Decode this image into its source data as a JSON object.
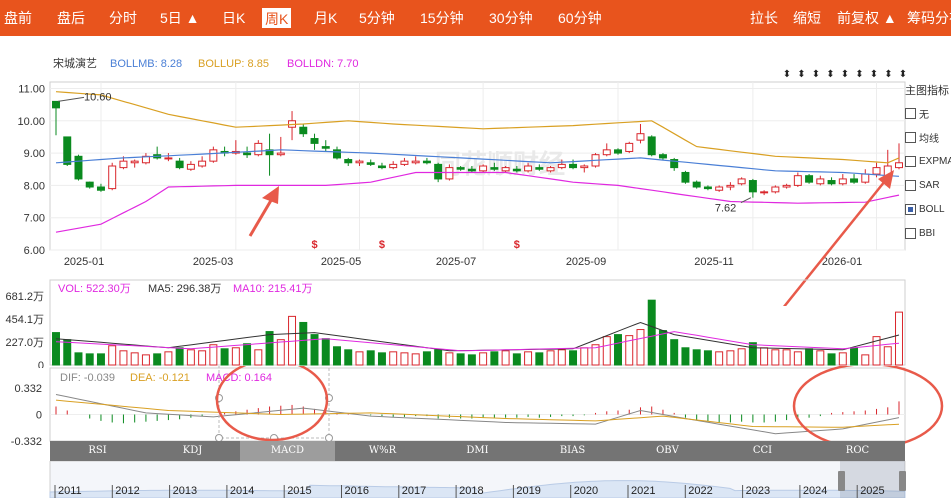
{
  "toolbar": {
    "left_items": [
      "盘前",
      "盘后",
      "分时",
      "5日 ▲",
      "日K",
      "周K",
      "月K",
      "5分钟",
      "15分钟",
      "30分钟",
      "60分钟"
    ],
    "active": "周K",
    "right_items": [
      "拉长",
      "缩短",
      "前复权 ▲",
      "筹码分布"
    ],
    "color": "#e8541d"
  },
  "legend": {
    "stock_name": "宋城演艺",
    "bollmb": "BOLLMB: 8.28",
    "bollup": "BOLLUP: 8.85",
    "bolldn": "BOLLDN: 7.70"
  },
  "indicator_panel": {
    "title": "主图指标",
    "items": [
      {
        "label": "无",
        "checked": false
      },
      {
        "label": "均线",
        "checked": false
      },
      {
        "label": "EXPMA",
        "checked": false
      },
      {
        "label": "SAR",
        "checked": false
      },
      {
        "label": "BOLL",
        "checked": true
      },
      {
        "label": "BBI",
        "checked": false
      }
    ]
  },
  "annotations": {
    "high": "10.60",
    "low": "7.62",
    "ex_rights_marker": "$",
    "dividend_marker": "⬍"
  },
  "vol_legend": {
    "vol": "VOL: 522.30万",
    "ma5": "MA5: 296.38万",
    "ma10": "MA10: 215.41万"
  },
  "macd_legend": {
    "dif": "DIF: -0.039",
    "dea": "DEA: -0.121",
    "macd": "MACD: 0.164"
  },
  "tabs": [
    "RSI",
    "KDJ",
    "MACD",
    "W%R",
    "DMI",
    "BIAS",
    "OBV",
    "CCI",
    "ROC"
  ],
  "active_tab": "MACD",
  "colors": {
    "up": "#d9262c",
    "down": "#0a8a1f",
    "mid": "#4a7fd6",
    "upper": "#d9a023",
    "lower": "#e029e0",
    "dif": "#888888",
    "dea": "#d9a023",
    "macd": "#e029e0",
    "annotation": "#e85a4a"
  },
  "chart_data": [
    {
      "type": "candlestick",
      "title": "宋城演艺 周K",
      "x_labels": [
        "2025-01",
        "2025-03",
        "2025-05",
        "2025-07",
        "2025-09",
        "2025-11",
        "2026-01"
      ],
      "y_ticks": [
        "6.00",
        "7.00",
        "8.00",
        "9.00",
        "10.00",
        "11.00"
      ],
      "ylim": [
        6,
        11.2
      ],
      "ohlc": [
        [
          10.6,
          10.4,
          10.6,
          9.55
        ],
        [
          9.5,
          8.65,
          9.5,
          8.6
        ],
        [
          8.9,
          8.2,
          8.95,
          8.15
        ],
        [
          8.1,
          7.95,
          8.12,
          7.9
        ],
        [
          7.95,
          7.85,
          8.05,
          7.8
        ],
        [
          7.9,
          8.6,
          8.7,
          7.85
        ],
        [
          8.55,
          8.75,
          8.9,
          8.5
        ],
        [
          8.7,
          8.75,
          8.8,
          8.55
        ],
        [
          8.7,
          8.9,
          9.0,
          8.65
        ],
        [
          8.95,
          8.85,
          9.2,
          8.8
        ],
        [
          8.85,
          8.85,
          9.0,
          8.75
        ],
        [
          8.75,
          8.55,
          8.85,
          8.5
        ],
        [
          8.5,
          8.65,
          8.75,
          8.45
        ],
        [
          8.6,
          8.75,
          8.9,
          8.55
        ],
        [
          8.75,
          9.1,
          9.2,
          8.7
        ],
        [
          9.05,
          9.0,
          9.2,
          8.9
        ],
        [
          9.0,
          9.05,
          9.4,
          8.95
        ],
        [
          9.0,
          8.95,
          9.2,
          8.85
        ],
        [
          8.95,
          9.3,
          9.4,
          8.9
        ],
        [
          9.1,
          8.95,
          9.6,
          8.3
        ],
        [
          8.95,
          9.0,
          9.5,
          8.9
        ],
        [
          9.8,
          10.0,
          10.3,
          9.4
        ],
        [
          9.8,
          9.6,
          9.9,
          9.5
        ],
        [
          9.45,
          9.3,
          9.6,
          9.1
        ],
        [
          9.2,
          9.15,
          9.4,
          9.05
        ],
        [
          9.1,
          8.85,
          9.2,
          8.8
        ],
        [
          8.8,
          8.7,
          8.85,
          8.6
        ],
        [
          8.7,
          8.75,
          8.8,
          8.6
        ],
        [
          8.7,
          8.65,
          8.8,
          8.6
        ],
        [
          8.6,
          8.55,
          8.7,
          8.5
        ],
        [
          8.55,
          8.65,
          8.75,
          8.5
        ],
        [
          8.65,
          8.75,
          8.85,
          8.6
        ],
        [
          8.7,
          8.75,
          8.9,
          8.65
        ],
        [
          8.75,
          8.7,
          8.85,
          8.65
        ],
        [
          8.65,
          8.2,
          8.7,
          8.1
        ],
        [
          8.2,
          8.55,
          8.65,
          8.15
        ],
        [
          8.55,
          8.5,
          8.6,
          8.45
        ],
        [
          8.5,
          8.45,
          8.6,
          8.4
        ],
        [
          8.45,
          8.6,
          8.65,
          8.4
        ],
        [
          8.55,
          8.5,
          8.7,
          8.45
        ],
        [
          8.45,
          8.55,
          8.6,
          8.4
        ],
        [
          8.5,
          8.45,
          8.6,
          8.4
        ],
        [
          8.45,
          8.6,
          8.7,
          8.4
        ],
        [
          8.55,
          8.5,
          8.65,
          8.45
        ],
        [
          8.45,
          8.55,
          8.6,
          8.4
        ],
        [
          8.55,
          8.65,
          8.8,
          8.5
        ],
        [
          8.65,
          8.55,
          8.8,
          8.5
        ],
        [
          8.55,
          8.6,
          8.65,
          8.4
        ],
        [
          8.6,
          8.95,
          9.0,
          8.55
        ],
        [
          8.95,
          9.1,
          9.3,
          8.9
        ],
        [
          9.1,
          9.0,
          9.15,
          8.95
        ],
        [
          9.05,
          9.3,
          9.35,
          9.0
        ],
        [
          9.4,
          9.6,
          9.9,
          9.3
        ],
        [
          9.5,
          8.95,
          9.55,
          8.9
        ],
        [
          8.95,
          8.85,
          9.0,
          8.8
        ],
        [
          8.8,
          8.55,
          8.85,
          8.45
        ],
        [
          8.4,
          8.1,
          8.45,
          8.05
        ],
        [
          8.1,
          7.95,
          8.15,
          7.9
        ],
        [
          7.95,
          7.9,
          8.0,
          7.85
        ],
        [
          7.85,
          7.95,
          8.0,
          7.8
        ],
        [
          7.95,
          8.0,
          8.1,
          7.85
        ],
        [
          8.05,
          8.2,
          8.25,
          8.0
        ],
        [
          8.15,
          7.8,
          8.2,
          7.62
        ],
        [
          7.8,
          7.8,
          7.85,
          7.7
        ],
        [
          7.8,
          7.95,
          8.0,
          7.75
        ],
        [
          7.95,
          8.0,
          8.05,
          7.9
        ],
        [
          8.0,
          8.3,
          8.4,
          7.95
        ],
        [
          8.3,
          8.1,
          8.35,
          8.05
        ],
        [
          8.05,
          8.2,
          8.3,
          8.0
        ],
        [
          8.15,
          8.05,
          8.25,
          8.0
        ],
        [
          8.05,
          8.2,
          8.35,
          8.0
        ],
        [
          8.2,
          8.1,
          8.35,
          8.05
        ],
        [
          8.1,
          8.35,
          8.5,
          8.05
        ],
        [
          8.35,
          8.55,
          8.7,
          8.25
        ],
        [
          8.3,
          8.6,
          9.1,
          8.2
        ],
        [
          8.55,
          8.7,
          9.3,
          8.5
        ]
      ],
      "boll_mid": [
        [
          0,
          8.7
        ],
        [
          6,
          8.85
        ],
        [
          12,
          8.95
        ],
        [
          20,
          9.1
        ],
        [
          28,
          9.0
        ],
        [
          36,
          8.85
        ],
        [
          44,
          8.7
        ],
        [
          52,
          8.85
        ],
        [
          58,
          8.65
        ],
        [
          64,
          8.45
        ],
        [
          70,
          8.4
        ],
        [
          75,
          8.28
        ]
      ],
      "boll_up": [
        [
          0,
          10.9
        ],
        [
          4,
          10.8
        ],
        [
          10,
          10.2
        ],
        [
          16,
          9.8
        ],
        [
          22,
          9.9
        ],
        [
          26,
          10.0
        ],
        [
          30,
          9.9
        ],
        [
          38,
          9.75
        ],
        [
          46,
          9.85
        ],
        [
          53,
          10.0
        ],
        [
          57,
          9.2
        ],
        [
          64,
          8.9
        ],
        [
          70,
          8.8
        ],
        [
          74,
          8.7
        ],
        [
          75,
          8.85
        ]
      ],
      "boll_dn": [
        [
          0,
          6.55
        ],
        [
          4,
          6.8
        ],
        [
          8,
          7.5
        ],
        [
          10,
          7.95
        ],
        [
          16,
          8.0
        ],
        [
          24,
          8.0
        ],
        [
          28,
          8.1
        ],
        [
          32,
          8.4
        ],
        [
          40,
          8.4
        ],
        [
          46,
          8.1
        ],
        [
          50,
          8.0
        ],
        [
          56,
          7.7
        ],
        [
          60,
          7.5
        ],
        [
          66,
          7.45
        ],
        [
          72,
          7.48
        ],
        [
          75,
          7.7
        ]
      ],
      "high_label": "10.60",
      "low_label": "7.62"
    },
    {
      "type": "bar",
      "title": "VOL",
      "unit": "万",
      "y_ticks": [
        "681.2万",
        "454.1万",
        "227.0万",
        "0"
      ],
      "ylim": [
        0,
        681.2
      ],
      "values": [
        320,
        250,
        120,
        110,
        110,
        190,
        140,
        120,
        100,
        110,
        130,
        170,
        150,
        140,
        200,
        160,
        170,
        210,
        150,
        330,
        250,
        480,
        420,
        300,
        260,
        180,
        150,
        130,
        140,
        120,
        130,
        120,
        110,
        130,
        150,
        120,
        110,
        100,
        120,
        130,
        140,
        110,
        130,
        120,
        140,
        150,
        140,
        170,
        200,
        280,
        300,
        290,
        350,
        640,
        340,
        250,
        170,
        150,
        140,
        130,
        140,
        160,
        220,
        170,
        150,
        150,
        130,
        160,
        140,
        110,
        120,
        170,
        100,
        280,
        180,
        522
      ],
      "ma5": [
        [
          0,
          260
        ],
        [
          10,
          170
        ],
        [
          19,
          300
        ],
        [
          23,
          320
        ],
        [
          35,
          140
        ],
        [
          46,
          160
        ],
        [
          52,
          420
        ],
        [
          55,
          300
        ],
        [
          62,
          170
        ],
        [
          70,
          150
        ],
        [
          75,
          296
        ]
      ],
      "ma10": [
        [
          0,
          230
        ],
        [
          12,
          160
        ],
        [
          24,
          260
        ],
        [
          36,
          140
        ],
        [
          48,
          170
        ],
        [
          55,
          330
        ],
        [
          62,
          200
        ],
        [
          70,
          160
        ],
        [
          75,
          215
        ]
      ]
    },
    {
      "type": "bar",
      "title": "MACD",
      "y_ticks": [
        "0.332",
        "0",
        "-0.332"
      ],
      "ylim": [
        -0.332,
        0.332
      ],
      "values": [
        0.1,
        0.05,
        0,
        -0.05,
        -0.08,
        -0.1,
        -0.11,
        -0.1,
        -0.09,
        -0.08,
        -0.07,
        -0.06,
        -0.04,
        -0.02,
        0,
        0.02,
        0.04,
        0.06,
        0.08,
        0.1,
        0.11,
        0.12,
        0.1,
        0.07,
        0.04,
        0.02,
        0.01,
        0,
        -0.01,
        -0.02,
        -0.03,
        -0.03,
        -0.02,
        -0.02,
        -0.05,
        -0.04,
        -0.05,
        -0.05,
        -0.04,
        -0.05,
        -0.04,
        -0.04,
        -0.03,
        -0.04,
        -0.03,
        -0.02,
        -0.02,
        -0.01,
        0.02,
        0.04,
        0.05,
        0.06,
        0.09,
        0.1,
        0.06,
        0.02,
        -0.04,
        -0.07,
        -0.09,
        -0.1,
        -0.1,
        -0.09,
        -0.1,
        -0.1,
        -0.09,
        -0.07,
        -0.05,
        -0.04,
        -0.02,
        0.02,
        0.03,
        0.04,
        0.05,
        0.07,
        0.09,
        0.164
      ],
      "dif": [
        [
          0,
          0.25
        ],
        [
          8,
          0.02
        ],
        [
          14,
          -0.03
        ],
        [
          22,
          0.08
        ],
        [
          28,
          -0.02
        ],
        [
          40,
          -0.1
        ],
        [
          48,
          -0.12
        ],
        [
          52,
          0.05
        ],
        [
          56,
          -0.05
        ],
        [
          64,
          -0.24
        ],
        [
          70,
          -0.18
        ],
        [
          75,
          -0.039
        ]
      ],
      "dea": [
        [
          0,
          0.18
        ],
        [
          10,
          0.05
        ],
        [
          20,
          0.0
        ],
        [
          28,
          0.02
        ],
        [
          40,
          -0.05
        ],
        [
          48,
          -0.08
        ],
        [
          54,
          -0.02
        ],
        [
          62,
          -0.15
        ],
        [
          70,
          -0.16
        ],
        [
          75,
          -0.121
        ]
      ]
    }
  ],
  "navigator": {
    "years": [
      "2011",
      "2012",
      "2013",
      "2014",
      "2015",
      "2016",
      "2017",
      "2018",
      "2019",
      "2020",
      "2021",
      "2022",
      "2023",
      "2024",
      "2025"
    ]
  }
}
